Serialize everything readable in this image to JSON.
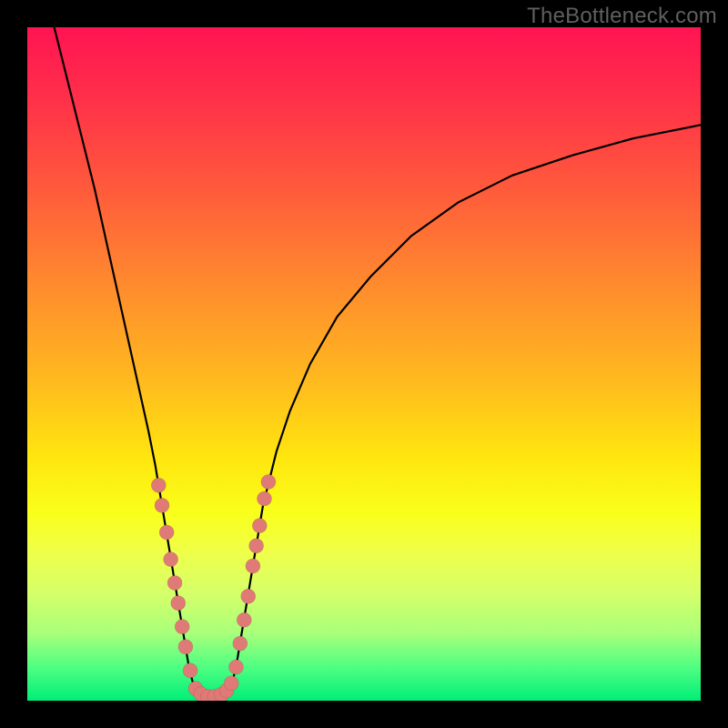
{
  "watermark": "TheBottleneck.com",
  "chart_data": {
    "type": "line",
    "title": "",
    "xlabel": "",
    "ylabel": "",
    "xlim": [
      0,
      100
    ],
    "ylim": [
      0,
      100
    ],
    "grid": false,
    "legend": false,
    "series": [
      {
        "name": "bottleneck-curve",
        "color": "#000000",
        "points": [
          {
            "x": 4,
            "y": 100
          },
          {
            "x": 6,
            "y": 92
          },
          {
            "x": 8,
            "y": 84
          },
          {
            "x": 10,
            "y": 76
          },
          {
            "x": 12,
            "y": 67
          },
          {
            "x": 14,
            "y": 58
          },
          {
            "x": 16,
            "y": 49
          },
          {
            "x": 18,
            "y": 40
          },
          {
            "x": 19,
            "y": 35
          },
          {
            "x": 19.5,
            "y": 32
          },
          {
            "x": 20,
            "y": 29
          },
          {
            "x": 20.5,
            "y": 26
          },
          {
            "x": 21,
            "y": 23
          },
          {
            "x": 21.5,
            "y": 20
          },
          {
            "x": 22,
            "y": 17
          },
          {
            "x": 22.5,
            "y": 14
          },
          {
            "x": 23,
            "y": 11
          },
          {
            "x": 23.5,
            "y": 8
          },
          {
            "x": 24,
            "y": 5
          },
          {
            "x": 24.5,
            "y": 3
          },
          {
            "x": 25,
            "y": 1.5
          },
          {
            "x": 26,
            "y": 0.7
          },
          {
            "x": 27,
            "y": 0.4
          },
          {
            "x": 28,
            "y": 0.4
          },
          {
            "x": 29,
            "y": 0.7
          },
          {
            "x": 30,
            "y": 1.5
          },
          {
            "x": 30.5,
            "y": 3
          },
          {
            "x": 31,
            "y": 5
          },
          {
            "x": 31.5,
            "y": 8
          },
          {
            "x": 32,
            "y": 11
          },
          {
            "x": 32.5,
            "y": 14
          },
          {
            "x": 33,
            "y": 17
          },
          {
            "x": 33.5,
            "y": 20
          },
          {
            "x": 34,
            "y": 23
          },
          {
            "x": 34.5,
            "y": 26
          },
          {
            "x": 35,
            "y": 29
          },
          {
            "x": 35.5,
            "y": 31
          },
          {
            "x": 36,
            "y": 33
          },
          {
            "x": 37,
            "y": 37
          },
          {
            "x": 39,
            "y": 43
          },
          {
            "x": 42,
            "y": 50
          },
          {
            "x": 46,
            "y": 57
          },
          {
            "x": 51,
            "y": 63
          },
          {
            "x": 57,
            "y": 69
          },
          {
            "x": 64,
            "y": 74
          },
          {
            "x": 72,
            "y": 78
          },
          {
            "x": 81,
            "y": 81
          },
          {
            "x": 90,
            "y": 83.5
          },
          {
            "x": 100,
            "y": 85.5
          }
        ]
      }
    ],
    "markers": [
      {
        "name": "left-arm-dots",
        "color": "#e07a76",
        "points": [
          {
            "x": 19.5,
            "y": 32
          },
          {
            "x": 20.0,
            "y": 29
          },
          {
            "x": 20.7,
            "y": 25
          },
          {
            "x": 21.3,
            "y": 21
          },
          {
            "x": 21.9,
            "y": 17.5
          },
          {
            "x": 22.4,
            "y": 14.5
          },
          {
            "x": 23.0,
            "y": 11
          },
          {
            "x": 23.5,
            "y": 8
          },
          {
            "x": 24.2,
            "y": 4.5
          }
        ]
      },
      {
        "name": "bottom-dots",
        "color": "#e07a76",
        "points": [
          {
            "x": 25.0,
            "y": 1.8
          },
          {
            "x": 25.8,
            "y": 1.0
          },
          {
            "x": 26.8,
            "y": 0.6
          },
          {
            "x": 27.8,
            "y": 0.6
          },
          {
            "x": 28.8,
            "y": 0.9
          },
          {
            "x": 29.6,
            "y": 1.5
          },
          {
            "x": 30.3,
            "y": 2.6
          }
        ]
      },
      {
        "name": "right-arm-dots",
        "color": "#e07a76",
        "points": [
          {
            "x": 31.0,
            "y": 5
          },
          {
            "x": 31.6,
            "y": 8.5
          },
          {
            "x": 32.2,
            "y": 12
          },
          {
            "x": 32.8,
            "y": 15.5
          },
          {
            "x": 33.5,
            "y": 20
          },
          {
            "x": 34.0,
            "y": 23
          },
          {
            "x": 34.5,
            "y": 26
          },
          {
            "x": 35.2,
            "y": 30
          },
          {
            "x": 35.8,
            "y": 32.5
          }
        ]
      }
    ]
  }
}
